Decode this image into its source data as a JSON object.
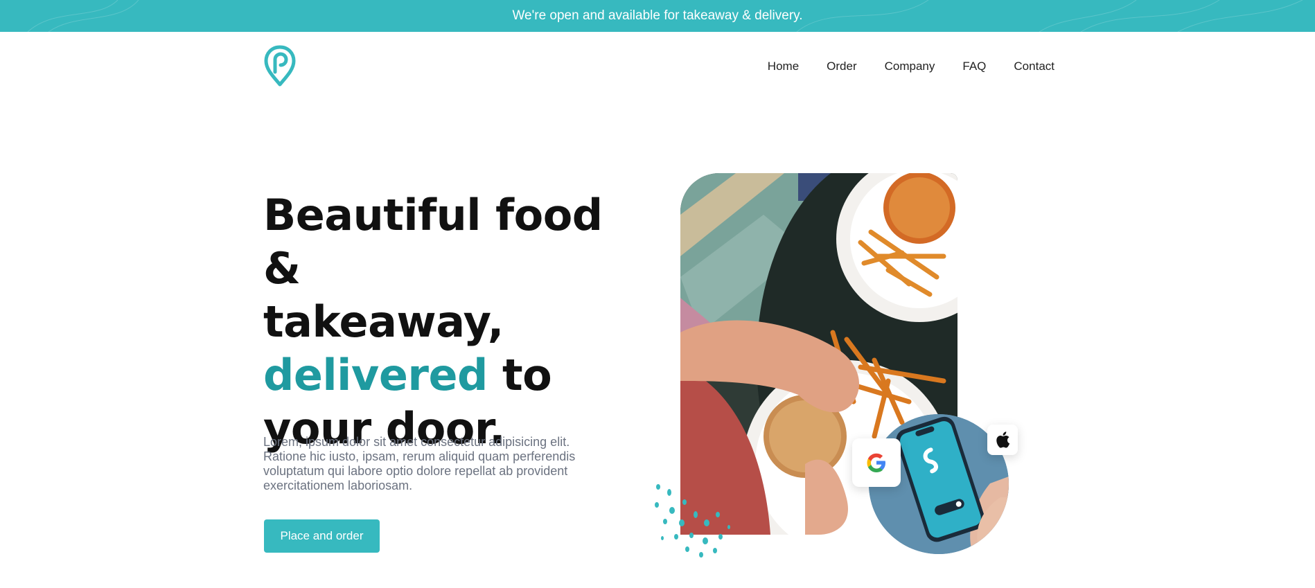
{
  "announcement": {
    "text": "We're open and available for takeaway & delivery."
  },
  "brand": {
    "logo_icon": "location-pin-logo-icon",
    "accent_color": "#37b9bf",
    "accent_text_color": "#1f9aa0"
  },
  "nav": {
    "items": [
      {
        "label": "Home"
      },
      {
        "label": "Order"
      },
      {
        "label": "Company"
      },
      {
        "label": "FAQ"
      },
      {
        "label": "Contact"
      }
    ]
  },
  "hero": {
    "headline_line1": "Beautiful food &",
    "headline_line2": "takeaway,",
    "headline_accent": "delivered",
    "headline_after_accent": " to",
    "headline_line4": "your door.",
    "lead": "Lorem, ipsum dolor sit amet consectetur adipisicing elit. Ratione hic iusto, ipsam, rerum aliquid quam perferendis voluptatum qui labore optio dolore repellat ab provident exercitationem laboriosam.",
    "cta_label": "Place and order"
  },
  "media": {
    "photo": "food-table-photo",
    "phone": "phone-in-hand-photo",
    "google_badge_icon": "google-icon",
    "apple_badge_icon": "apple-icon"
  }
}
